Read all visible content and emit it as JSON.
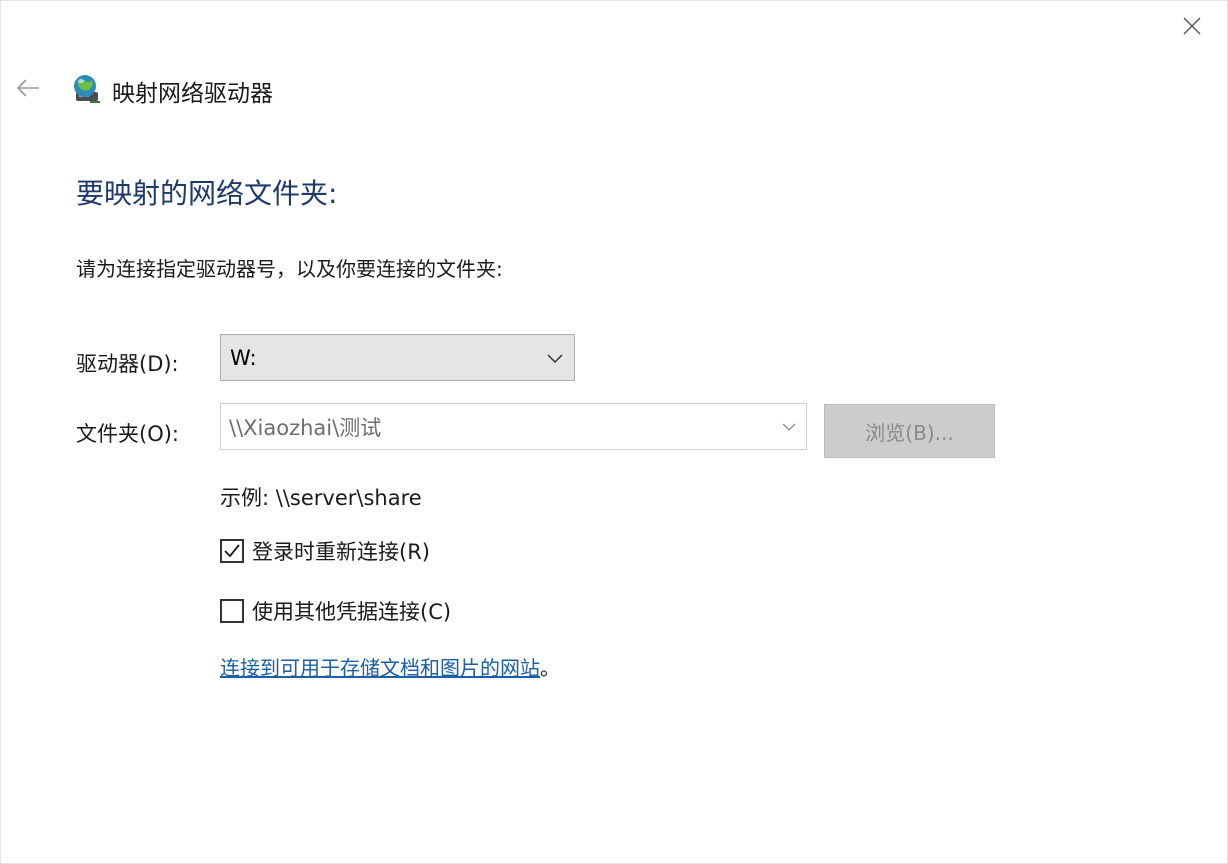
{
  "window": {
    "title": "映射网络驱动器",
    "icons": {
      "close": "close-icon",
      "back": "back-arrow-icon",
      "app": "network-drive-icon"
    }
  },
  "main": {
    "heading": "要映射的网络文件夹:",
    "instruction": "请为连接指定驱动器号，以及你要连接的文件夹:",
    "drive": {
      "label": "驱动器(D):",
      "value": "W:"
    },
    "folder": {
      "label": "文件夹(O):",
      "value": "\\\\Xiaozhai\\测试",
      "browse_label": "浏览(B)..."
    },
    "example": "示例: \\\\server\\share",
    "options": [
      {
        "label": "登录时重新连接(R)",
        "checked": true
      },
      {
        "label": "使用其他凭据连接(C)",
        "checked": false
      }
    ],
    "link_text": "连接到可用于存储文档和图片的网站",
    "link_suffix": "。"
  },
  "colors": {
    "heading": "#1e3a6b",
    "link": "#1a5fa8",
    "disabled_button": "#cccccc",
    "select_background": "#e5e5e5"
  }
}
